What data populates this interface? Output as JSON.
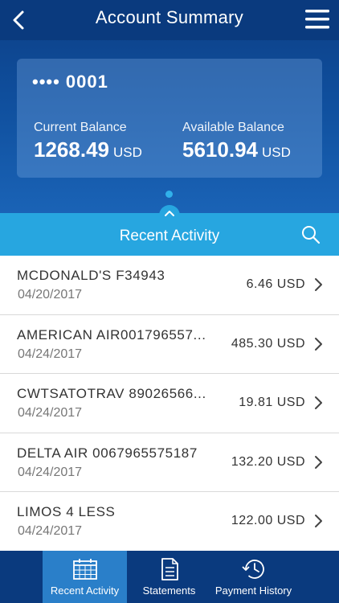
{
  "header": {
    "title": "Account Summary",
    "back_icon": "chevron-left-icon",
    "menu_icon": "hamburger-menu-icon"
  },
  "account": {
    "masked_number": "•••• 0001",
    "current_balance_label": "Current Balance",
    "current_balance": "1268.49",
    "current_balance_currency": "USD",
    "available_balance_label": "Available Balance",
    "available_balance": "5610.94",
    "available_balance_currency": "USD"
  },
  "activity": {
    "title": "Recent Activity",
    "search_icon": "search-icon",
    "transactions": [
      {
        "merchant": "MCDONALD'S F34943",
        "date": "04/20/2017",
        "amount": "6.46 USD"
      },
      {
        "merchant": "AMERICAN AIR001796557...",
        "date": "04/24/2017",
        "amount": "485.30 USD"
      },
      {
        "merchant": "CWTSATOTRAV 89026566...",
        "date": "04/24/2017",
        "amount": "19.81 USD"
      },
      {
        "merchant": "DELTA AIR 0067965575187",
        "date": "04/24/2017",
        "amount": "132.20 USD"
      },
      {
        "merchant": "LIMOS 4 LESS",
        "date": "04/24/2017",
        "amount": "122.00 USD"
      }
    ]
  },
  "tabs": [
    {
      "label": "Recent Activity",
      "icon": "calendar-icon",
      "active": true
    },
    {
      "label": "Statements",
      "icon": "document-icon",
      "active": false
    },
    {
      "label": "Payment History",
      "icon": "clock-history-icon",
      "active": false
    }
  ],
  "colors": {
    "header_dark": "#0a3a7e",
    "accent_blue": "#27a6e0",
    "active_tab": "#2a7fc9"
  }
}
